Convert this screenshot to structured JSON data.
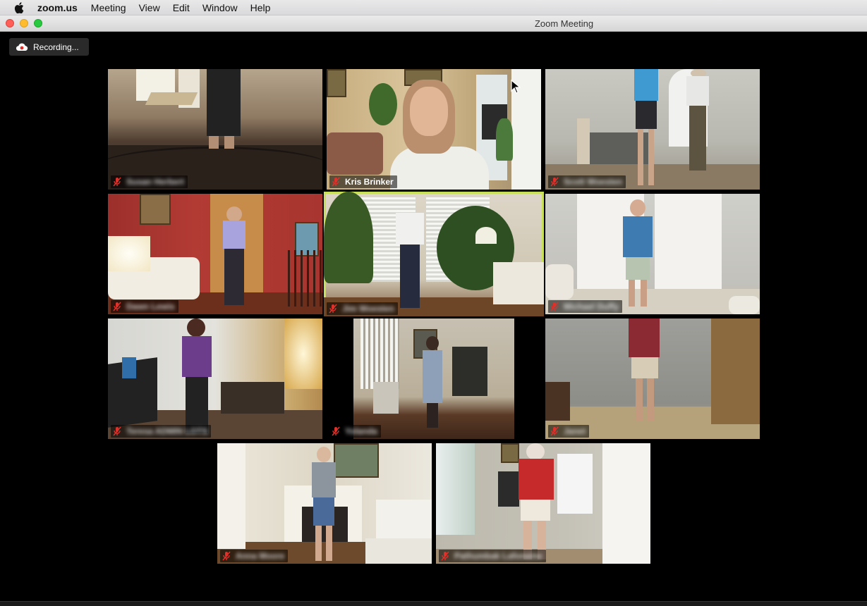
{
  "menubar": {
    "app_name": "zoom.us",
    "items": [
      "Meeting",
      "View",
      "Edit",
      "Window",
      "Help"
    ]
  },
  "window": {
    "title": "Zoom Meeting"
  },
  "recording": {
    "label": "Recording..."
  },
  "participants": [
    {
      "name": "Susan Herbert"
    },
    {
      "name": "Kris Brinker"
    },
    {
      "name": "Scott Woesten"
    },
    {
      "name": "Dawn Lewis"
    },
    {
      "name": "Jim Woesten"
    },
    {
      "name": "Michael Duffy"
    },
    {
      "name": "Teresa ADMIN LOTS"
    },
    {
      "name": "Yolanda"
    },
    {
      "name": "Janet"
    },
    {
      "name": "Anna Moore"
    },
    {
      "name": "Pathumbak Lafonaine"
    }
  ],
  "icons": {
    "apple": "apple-logo-icon",
    "mic_muted": "mic-muted-icon",
    "cloud_record": "cloud-recording-icon",
    "cursor": "mouse-pointer-icon"
  },
  "colors": {
    "active_speaker_border": "#c8df59",
    "muted_mic": "#e0302a",
    "background": "#000000"
  }
}
